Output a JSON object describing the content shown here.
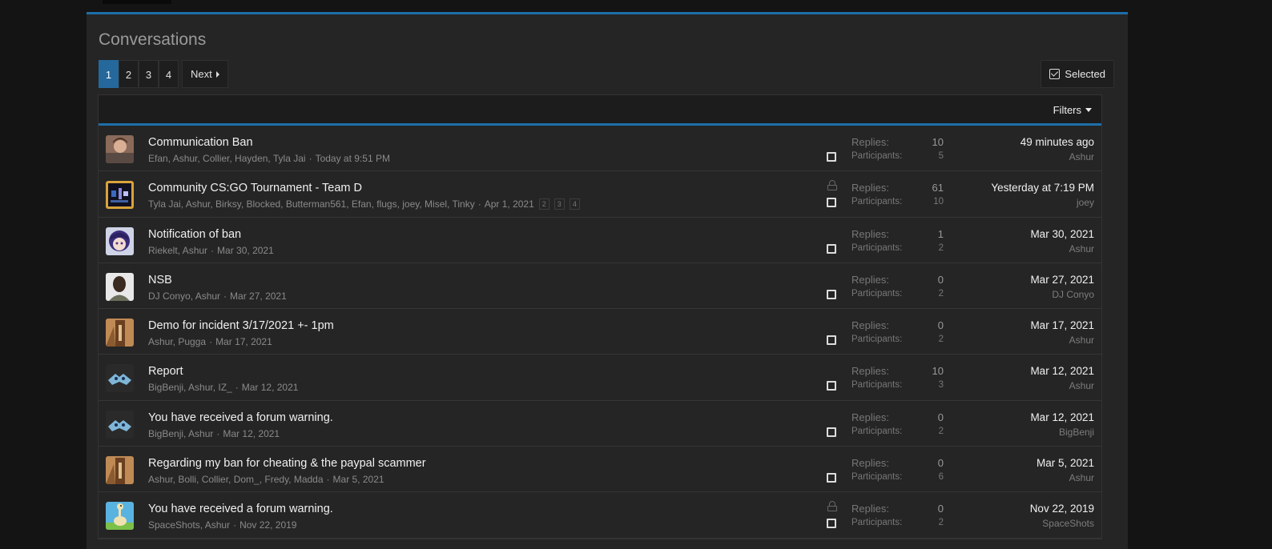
{
  "page": {
    "title": "Conversations"
  },
  "pagination": {
    "pages": [
      "1",
      "2",
      "3",
      "4"
    ],
    "current": "1",
    "next_label": "Next"
  },
  "selected_label": "Selected",
  "filters_label": "Filters",
  "labels": {
    "replies": "Replies:",
    "participants": "Participants:"
  },
  "conversations": [
    {
      "title": "Communication Ban",
      "participants_list": "Efan, Ashur, Collier, Hayden, Tyla Jai",
      "date": "Today at 9:51 PM",
      "replies": "10",
      "participants": "5",
      "last_date": "49 minutes ago",
      "last_user": "Ashur",
      "locked": false,
      "pages": []
    },
    {
      "title": "Community CS:GO Tournament - Team D",
      "participants_list": "Tyla Jai, Ashur, Birksy, Blocked, Butterman561, Efan, flugs, joey, Misel, Tinky",
      "date": "Apr 1, 2021",
      "replies": "61",
      "participants": "10",
      "last_date": "Yesterday at 7:19 PM",
      "last_user": "joey",
      "locked": true,
      "pages": [
        "2",
        "3",
        "4"
      ]
    },
    {
      "title": "Notification of ban",
      "participants_list": "Riekelt, Ashur",
      "date": "Mar 30, 2021",
      "replies": "1",
      "participants": "2",
      "last_date": "Mar 30, 2021",
      "last_user": "Ashur",
      "locked": false,
      "pages": []
    },
    {
      "title": "NSB",
      "participants_list": "DJ Conyo, Ashur",
      "date": "Mar 27, 2021",
      "replies": "0",
      "participants": "2",
      "last_date": "Mar 27, 2021",
      "last_user": "DJ Conyo",
      "locked": false,
      "pages": []
    },
    {
      "title": "Demo for incident 3/17/2021 +- 1pm",
      "participants_list": "Ashur, Pugga",
      "date": "Mar 17, 2021",
      "replies": "0",
      "participants": "2",
      "last_date": "Mar 17, 2021",
      "last_user": "Ashur",
      "locked": false,
      "pages": []
    },
    {
      "title": "Report",
      "participants_list": "BigBenji, Ashur, IZ_",
      "date": "Mar 12, 2021",
      "replies": "10",
      "participants": "3",
      "last_date": "Mar 12, 2021",
      "last_user": "Ashur",
      "locked": false,
      "pages": []
    },
    {
      "title": "You have received a forum warning.",
      "participants_list": "BigBenji, Ashur",
      "date": "Mar 12, 2021",
      "replies": "0",
      "participants": "2",
      "last_date": "Mar 12, 2021",
      "last_user": "BigBenji",
      "locked": false,
      "pages": []
    },
    {
      "title": "Regarding my ban for cheating & the paypal scammer",
      "participants_list": "Ashur, Bolli, Collier, Dom_, Fredy, Madda",
      "date": "Mar 5, 2021",
      "replies": "0",
      "participants": "6",
      "last_date": "Mar 5, 2021",
      "last_user": "Ashur",
      "locked": false,
      "pages": []
    },
    {
      "title": "You have received a forum warning.",
      "participants_list": "SpaceShots, Ashur",
      "date": "Nov 22, 2019",
      "replies": "0",
      "participants": "2",
      "last_date": "Nov 22, 2019",
      "last_user": "SpaceShots",
      "locked": true,
      "pages": []
    }
  ],
  "avatars": [
    "avatar-person-photo",
    "avatar-tournament-logo",
    "avatar-anime-character",
    "avatar-man-photo",
    "avatar-brown-figure",
    "avatar-blue-creature",
    "avatar-blue-creature",
    "avatar-brown-figure",
    "avatar-ostrich-cartoon"
  ]
}
